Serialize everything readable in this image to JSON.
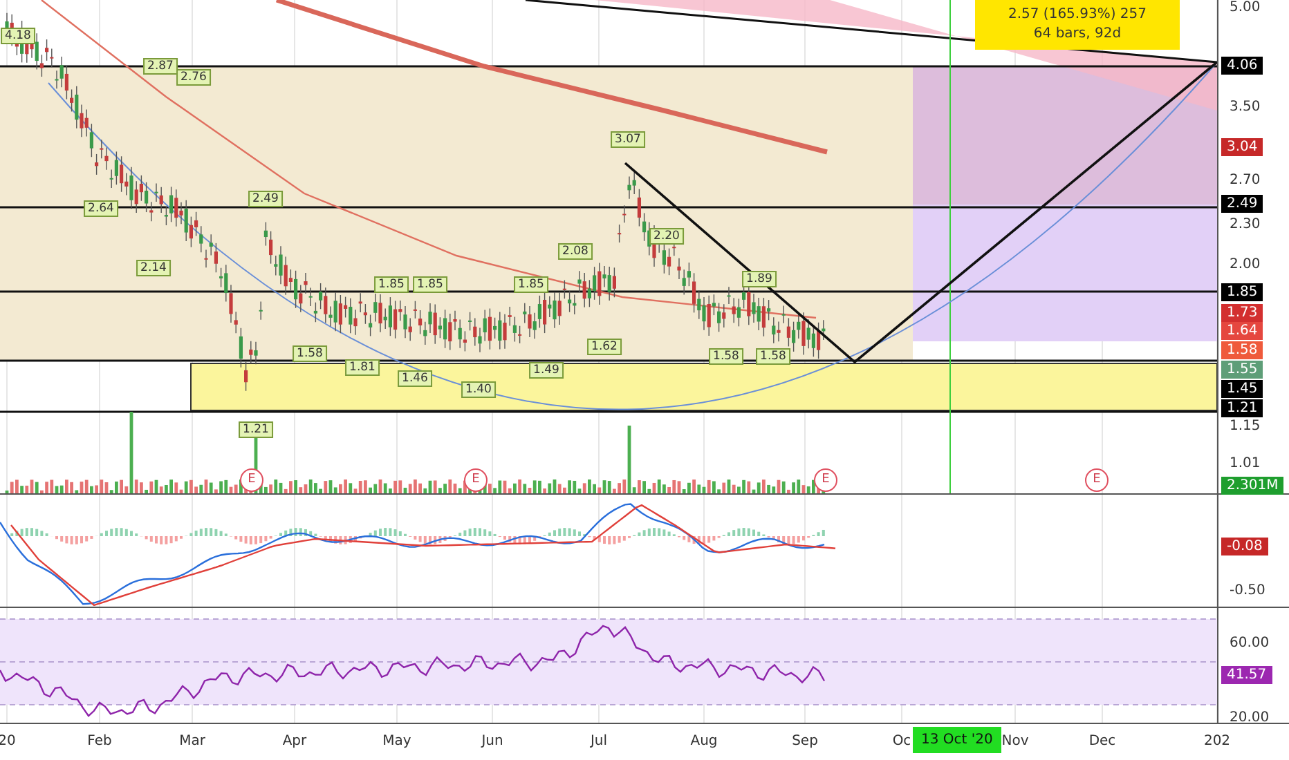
{
  "measure": {
    "lines": [
      "2.57 (165.93%) 257",
      "64 bars, 92d"
    ]
  },
  "callouts": [
    "4.18",
    "2.87",
    "2.76",
    "2.64",
    "2.14",
    "2.49",
    "1.21",
    "1.58",
    "1.81",
    "1.85",
    "1.85",
    "1.46",
    "1.40",
    "1.85",
    "1.49",
    "2.08",
    "1.62",
    "3.07",
    "2.20",
    "1.89",
    "1.58",
    "1.58"
  ],
  "earnings": [
    "E",
    "E",
    "E",
    "E"
  ],
  "price_axis": {
    "ticks": [
      "5.00",
      "3.50",
      "2.70",
      "2.30",
      "2.00",
      "1.15",
      "1.01"
    ],
    "tags": [
      {
        "text": "4.06",
        "color": "#000000"
      },
      {
        "text": "3.04",
        "color": "#c62828"
      },
      {
        "text": "2.49",
        "color": "#000000"
      },
      {
        "text": "1.85",
        "color": "#000000"
      },
      {
        "text": "1.73",
        "color": "#d32f2f"
      },
      {
        "text": "1.64",
        "color": "#e5473f"
      },
      {
        "text": "1.58",
        "color": "#ef5a3c"
      },
      {
        "text": "1.55",
        "color": "#5e9e78"
      },
      {
        "text": "1.45",
        "color": "#000000"
      },
      {
        "text": "1.21",
        "color": "#000000"
      },
      {
        "text": "2.301M",
        "color": "#1e9e2e"
      }
    ]
  },
  "macd": {
    "ticks": [
      "-0.50"
    ],
    "tags": [
      {
        "text": "-0.08",
        "color": "#c62828"
      }
    ]
  },
  "rsi": {
    "ticks": [
      "60.00",
      "20.00"
    ],
    "tags": [
      {
        "text": "41.57",
        "color": "#9c27b0"
      }
    ]
  },
  "time_axis": {
    "labels": [
      "20",
      "Feb",
      "Mar",
      "Apr",
      "May",
      "Jun",
      "Jul",
      "Aug",
      "Sep",
      "Oc",
      "Nov",
      "Dec",
      "202"
    ],
    "marker": "13 Oct '20"
  }
}
